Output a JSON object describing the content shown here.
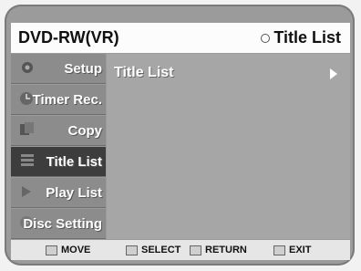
{
  "header": {
    "left_title": "DVD-RW(VR)",
    "right_title": "Title List"
  },
  "sidebar": {
    "items": [
      {
        "label": "Setup",
        "icon": "gear-icon",
        "active": false
      },
      {
        "label": "Timer Rec.",
        "icon": "clock-icon",
        "active": false
      },
      {
        "label": "Copy",
        "icon": "copy-icon",
        "active": false
      },
      {
        "label": "Title List",
        "icon": "list-icon",
        "active": true
      },
      {
        "label": "Play List",
        "icon": "playlist-icon",
        "active": false
      },
      {
        "label": "Disc Setting",
        "icon": "disc-icon",
        "active": false
      }
    ]
  },
  "main": {
    "row_label": "Title List"
  },
  "footer": {
    "move": "MOVE",
    "select": "SELECT",
    "return": "RETURN",
    "exit": "EXIT"
  },
  "colors": {
    "active_item": "#3d3d3d",
    "inactive_item": "#8c8c8c",
    "content_bg": "#a6a6a6"
  }
}
